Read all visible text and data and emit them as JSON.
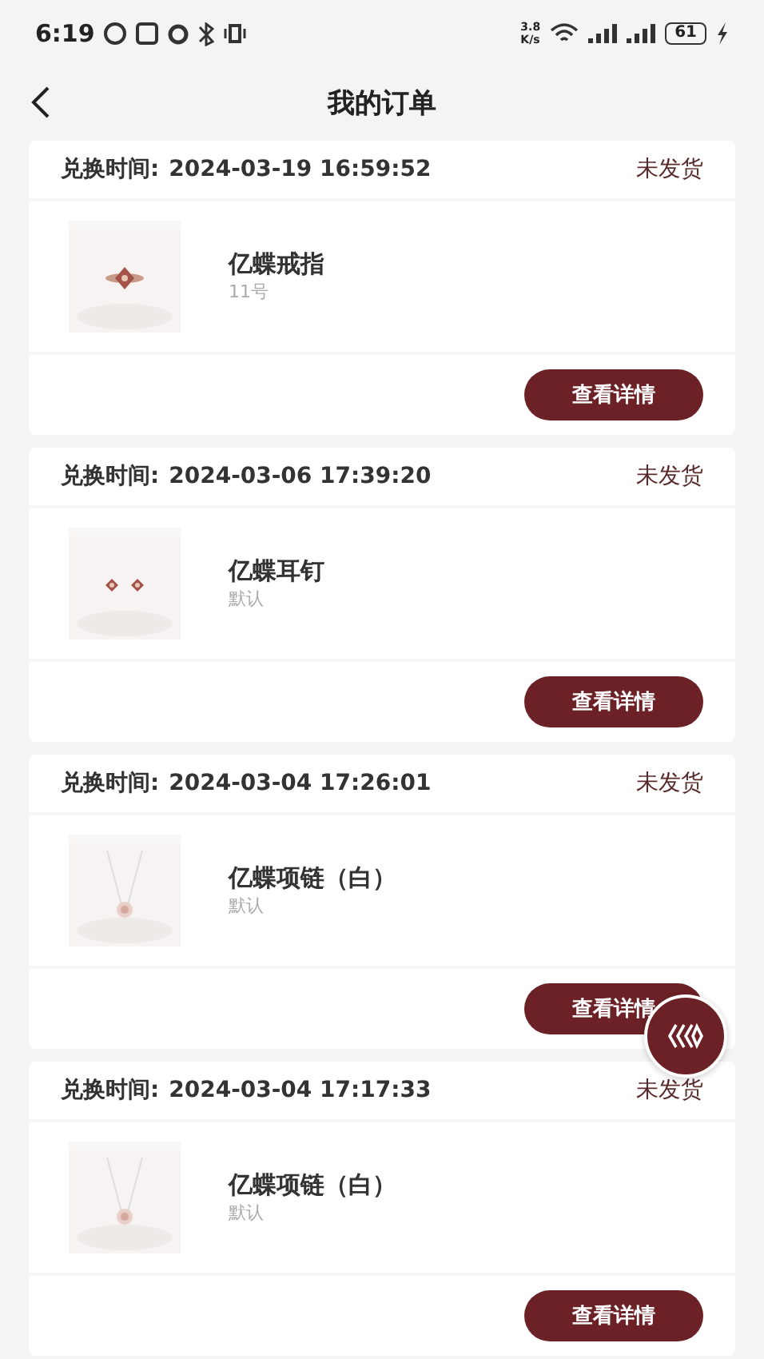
{
  "status_bar": {
    "time": "6:19",
    "net_speed": "3.8",
    "net_unit": "K/s",
    "battery": "61"
  },
  "header": {
    "title": "我的订单"
  },
  "orders": [
    {
      "time_label": "兑换时间:",
      "time": "2024-03-19 16:59:52",
      "status": "未发货",
      "product": {
        "name": "亿蝶戒指",
        "spec": "11号",
        "kind": "ring"
      },
      "button": "查看详情"
    },
    {
      "time_label": "兑换时间:",
      "time": "2024-03-06 17:39:20",
      "status": "未发货",
      "product": {
        "name": "亿蝶耳钉",
        "spec": "默认",
        "kind": "earrings"
      },
      "button": "查看详情"
    },
    {
      "time_label": "兑换时间:",
      "time": "2024-03-04 17:26:01",
      "status": "未发货",
      "product": {
        "name": "亿蝶项链（白）",
        "spec": "默认",
        "kind": "necklace"
      },
      "button": "查看详情"
    },
    {
      "time_label": "兑换时间:",
      "time": "2024-03-04 17:17:33",
      "status": "未发货",
      "product": {
        "name": "亿蝶项链（白）",
        "spec": "默认",
        "kind": "necklace"
      },
      "button": "查看详情"
    }
  ]
}
